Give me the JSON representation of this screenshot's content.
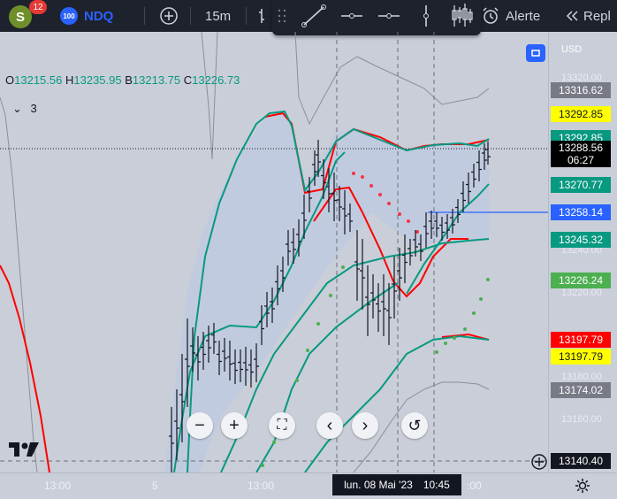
{
  "toolbar": {
    "avatar_letter": "S",
    "notification_count": "12",
    "symbol_badge": "100",
    "symbol": "NDQ",
    "interval": "15m",
    "alert_label": "Alerte",
    "replay_label": "Repl"
  },
  "legend": {
    "o_label": "O",
    "o_value": "13215.56",
    "h_label": "H",
    "h_value": "13235.95",
    "b_label": "B",
    "b_value": "13213.75",
    "c_label": "C",
    "c_value": "13226.73",
    "indicator_count": "3"
  },
  "price_scale": {
    "currency": "USD",
    "grey_ticks": [
      "13320.00",
      "13240.00",
      "13220.00",
      "13180.00",
      "13160.00"
    ],
    "labels": [
      {
        "text": "13316.62",
        "bg": "#787b86",
        "fg": "#ffffff"
      },
      {
        "text": "13292.85",
        "bg": "#ffff00",
        "fg": "#131722"
      },
      {
        "text": "13292.85",
        "bg": "#089981",
        "fg": "#ffffff"
      },
      {
        "text": "13288.56",
        "sub": "06:27",
        "bg": "#000000",
        "fg": "#ffffff"
      },
      {
        "text": "13270.77",
        "bg": "#089981",
        "fg": "#ffffff"
      },
      {
        "text": "13258.14",
        "bg": "#2962ff",
        "fg": "#ffffff"
      },
      {
        "text": "13245.32",
        "bg": "#089981",
        "fg": "#ffffff"
      },
      {
        "text": "13226.24",
        "bg": "#4caf50",
        "fg": "#ffffff"
      },
      {
        "text": "13197.79",
        "bg": "#ff0000",
        "fg": "#ffffff"
      },
      {
        "text": "13197.79",
        "bg": "#ffff00",
        "fg": "#131722"
      },
      {
        "text": "13174.02",
        "bg": "#787b86",
        "fg": "#ffffff"
      },
      {
        "text": "13140.40",
        "bg": "#131722",
        "fg": "#ffffff"
      }
    ]
  },
  "time_scale": {
    "ticks": [
      "13:00",
      "5",
      "13:00",
      ":00"
    ],
    "crosshair_date": "lun. 08 Mai '23",
    "crosshair_time": "10:45"
  },
  "colors": {
    "up": "#089981",
    "band_red": "#ff0000",
    "band_green": "#089981",
    "sar": "#4caf50",
    "sar_red": "#f23645",
    "line_blue": "#2962ff"
  }
}
